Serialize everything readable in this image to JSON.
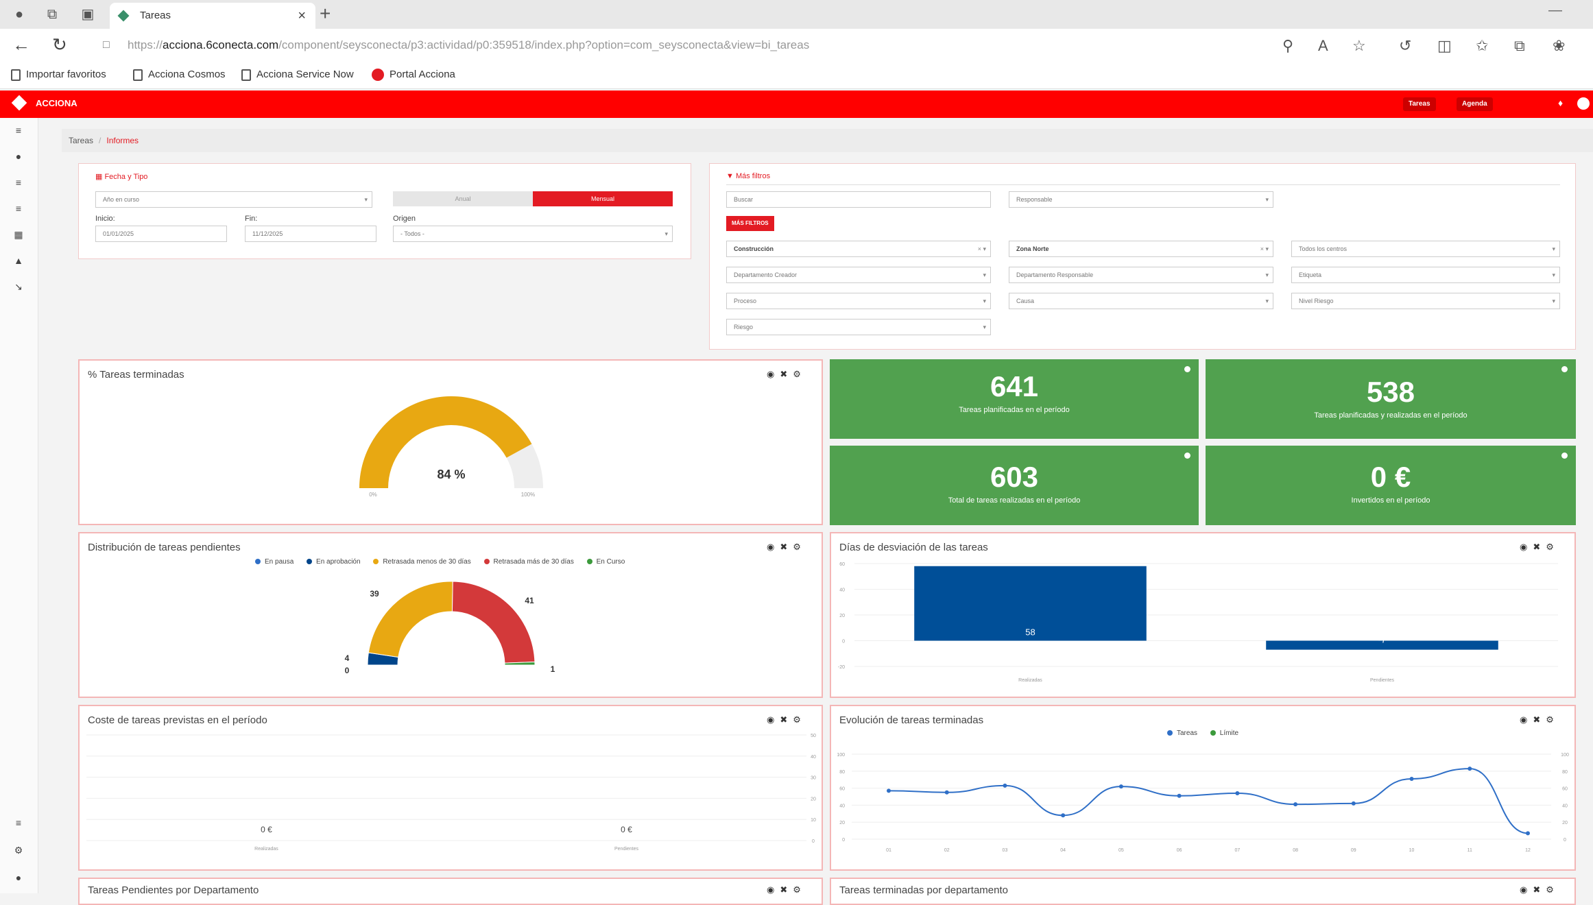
{
  "browser": {
    "tab_title": "Tareas",
    "url_prefix": "https://",
    "url_host": "acciona.6conecta.com",
    "url_path": "/component/seysconecta/p3:actividad/p0:359518/index.php?option=com_seysconecta&view=bi_tareas",
    "bookmarks": [
      "Importar favoritos",
      "Acciona Cosmos",
      "Acciona Service Now",
      "Portal Acciona"
    ]
  },
  "app": {
    "brand": "ACCIONA",
    "header_buttons": [
      "Tareas",
      "Agenda"
    ],
    "breadcrumb": [
      "Tareas",
      "Informes"
    ]
  },
  "filters_left": {
    "title": "Fecha y Tipo",
    "period_value": "Año en curso",
    "toggle_off": "Anual",
    "toggle_on": "Mensual",
    "start_label": "Inicio:",
    "start_value": "01/01/2025",
    "end_label": "Fin:",
    "end_value": "11/12/2025",
    "origin_label": "Origen",
    "origin_value": "- Todos -"
  },
  "filters_right": {
    "title": "Más filtros",
    "search_placeholder": "Buscar",
    "responsible_placeholder": "Responsable",
    "more_filters_button": "MÁS FILTROS",
    "field_1": "Construcción",
    "field_2": "Zona Norte",
    "field_3": "Todos los centros",
    "field_4": "Departamento Creador",
    "field_5": "Departamento Responsable",
    "field_6": "Etiqueta",
    "field_7": "Proceso",
    "field_8": "Causa",
    "field_9": "Nivel Riesgo",
    "field_10": "Riesgo"
  },
  "cards": {
    "completed_pct": {
      "title": "% Tareas terminadas",
      "value": "84 %",
      "min_label": "0%",
      "max_label": "100%",
      "percent": 84
    },
    "kpis": [
      {
        "value": "641",
        "label": "Tareas planificadas en el período"
      },
      {
        "value": "538",
        "label": "Tareas planificadas y realizadas en el período"
      },
      {
        "value": "603",
        "label": "Total de tareas realizadas en el período"
      },
      {
        "value": "0 €",
        "label": "Invertidos en el período"
      }
    ],
    "pending": {
      "title": "Distribución de tareas pendientes"
    },
    "deviation": {
      "title": "Días de desviación de las tareas"
    },
    "cost": {
      "title": "Coste de tareas previstas en el período"
    },
    "evolution": {
      "title": "Evolución de tareas terminadas"
    },
    "pending_dept": {
      "title": "Tareas Pendientes por Departamento"
    },
    "done_dept": {
      "title": "Tareas terminadas por departamento"
    }
  },
  "chart_data": [
    {
      "type": "pie",
      "title": "Distribución de tareas pendientes",
      "series": [
        {
          "name": "En pausa",
          "value": 0,
          "color": "#2f6fc7"
        },
        {
          "name": "En aprobación",
          "value": 4,
          "color": "#00458a"
        },
        {
          "name": "Retrasada menos de 30 días",
          "value": 39,
          "color": "#e8a812"
        },
        {
          "name": "Retrasada más de 30 días",
          "value": 41,
          "color": "#d3393a"
        },
        {
          "name": "En Curso",
          "value": 1,
          "color": "#3c9a3c"
        }
      ]
    },
    {
      "type": "bar",
      "title": "Días de desviación de las tareas",
      "categories": [
        "Realizadas",
        "Pendientes"
      ],
      "values": [
        58,
        -7
      ],
      "value_labels": [
        "58",
        "-7"
      ],
      "ylim": [
        -20,
        60
      ],
      "yticks": [
        "-20",
        "0",
        "20",
        "40",
        "60"
      ],
      "color": "#004f98"
    },
    {
      "type": "bar",
      "title": "Coste de tareas previstas en el período",
      "categories": [
        "Realizadas",
        "Pendientes"
      ],
      "values": [
        0,
        0
      ],
      "value_labels": [
        "0 €",
        "0 €"
      ],
      "yticks": [
        "0",
        "10",
        "20",
        "30",
        "40",
        "50"
      ]
    },
    {
      "type": "line",
      "title": "Evolución de tareas terminadas",
      "legend": [
        "Tareas",
        "Límite"
      ],
      "legend_colors": [
        "#2f6fc7",
        "#3c9a3c"
      ],
      "values": [
        57,
        55,
        63,
        28,
        62,
        51,
        54,
        41,
        42,
        71,
        83,
        7
      ],
      "ylim": [
        0,
        100
      ],
      "yticks": [
        "0",
        "20",
        "40",
        "60",
        "80",
        "100"
      ],
      "y2ticks": [
        "0",
        "20",
        "40",
        "60",
        "80",
        "100"
      ],
      "xlabels": [
        "01",
        "02",
        "03",
        "04",
        "05",
        "06",
        "07",
        "08",
        "09",
        "10",
        "11",
        "12"
      ],
      "color": "#2f6fc7"
    }
  ]
}
